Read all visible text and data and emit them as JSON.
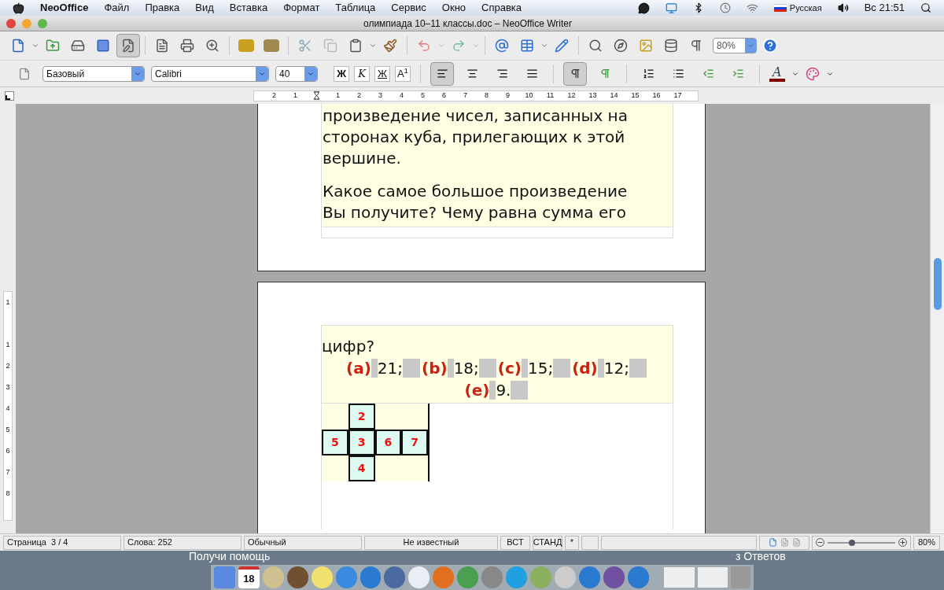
{
  "menubar": {
    "app_name": "NeoOffice",
    "menus": [
      "Файл",
      "Правка",
      "Вид",
      "Вставка",
      "Формат",
      "Таблица",
      "Сервис",
      "Окно",
      "Справка"
    ],
    "input_source": "Русская",
    "clock": "Вс 21:51"
  },
  "window": {
    "title": "олимпиада 10–11 классы.doc – NeoOffice Writer"
  },
  "standard_toolbar": {
    "edit_mode_on": true,
    "zoom": "80%"
  },
  "formatting_toolbar": {
    "style": "Базовый",
    "font": "Calibri",
    "size": "40",
    "format_buttons": [
      {
        "kind": "bold",
        "label": "Ж"
      },
      {
        "kind": "italic",
        "label": "K"
      },
      {
        "kind": "underline",
        "label": "Ж"
      },
      {
        "kind": "superscript",
        "label": "A$^{1}$"
      }
    ],
    "alignment": [
      {
        "selected": true
      },
      {
        "selected": false
      },
      {
        "selected": false
      },
      {
        "selected": false
      }
    ],
    "direction": [
      {
        "selected": true
      },
      {
        "selected": false
      }
    ],
    "font_color_glyph": "A"
  },
  "ruler": {
    "left_labels": [
      "2",
      "1"
    ],
    "right_labels": [
      "1",
      "2",
      "3",
      "4",
      "5",
      "6",
      "7",
      "8",
      "9",
      "10",
      "11",
      "12",
      "13",
      "14",
      "15",
      "16",
      "17"
    ]
  },
  "vertical_ruler": [
    "1",
    "1",
    "2",
    "3",
    "4",
    "5",
    "6",
    "7",
    "8"
  ],
  "page_1": {
    "lines": [
      "произведение чисел, записанных на",
      "сторонах куба, прилегающих к этой",
      "вершине."
    ],
    "paragraph_2": [
      "Какое самое большое произведение",
      "Вы получите? Чему равна сумма его"
    ]
  },
  "page_2": {
    "question_end": "цифр?",
    "options": [
      {
        "letter": "(a)",
        "value": "21;"
      },
      {
        "letter": "(b)",
        "value": "18;"
      },
      {
        "letter": "(c)",
        "value": "15;"
      },
      {
        "letter": "(d)",
        "value": "12;"
      },
      {
        "letter": "(e)",
        "value": "9."
      }
    ],
    "cube_net": [
      {
        "cells": [
          {
            "kind": "empty"
          },
          {
            "kind": "face",
            "label": "2"
          },
          {
            "kind": "empty"
          },
          {
            "kind": "empty"
          }
        ]
      },
      {
        "cells": [
          {
            "kind": "face",
            "label": "5"
          },
          {
            "kind": "face",
            "label": "3"
          },
          {
            "kind": "face",
            "label": "6"
          },
          {
            "kind": "face",
            "label": "7"
          }
        ]
      },
      {
        "cells": [
          {
            "kind": "empty"
          },
          {
            "kind": "face",
            "label": "4"
          },
          {
            "kind": "empty"
          },
          {
            "kind": "empty"
          }
        ]
      }
    ]
  },
  "status_bar": {
    "page": "Страница  3 / 4",
    "words": "Слова: 252",
    "page_style": "Обычный",
    "language": "Не известный",
    "insert_mode": "ВСТ",
    "selection_mode": "СТАНД",
    "modified": "*",
    "zoom_slider": {
      "level": 0.36
    },
    "zoom": "80%"
  },
  "desktop": {
    "text_left": "Получи помощь",
    "text_right": "з Ответов",
    "calendar_day": "18"
  }
}
